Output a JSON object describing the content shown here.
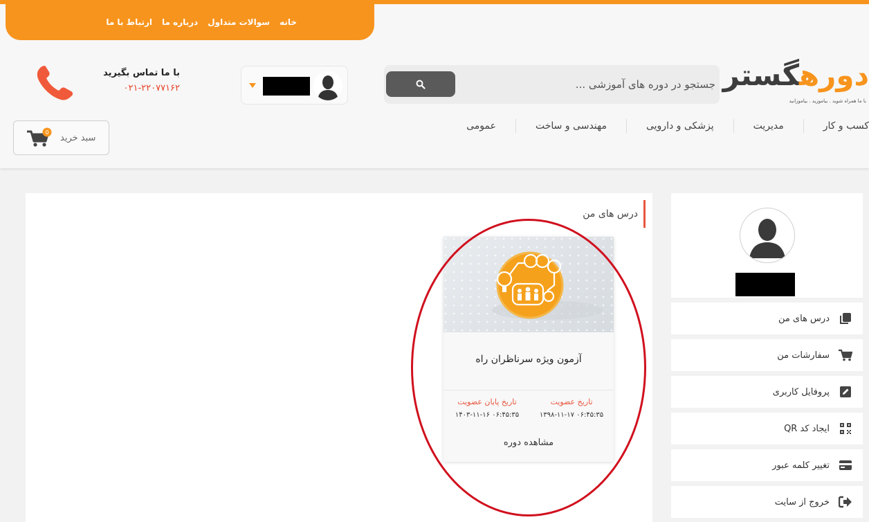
{
  "top_nav": {
    "home": "خانه",
    "faq": "سوالات متداول",
    "about": "درباره ما",
    "contact": "ارتباط با ما"
  },
  "logo": {
    "orange": "دوره",
    "dark": "گستر",
    "tagline": "با ما همراه شوید . بیاموزید . بیاموزانید"
  },
  "search": {
    "placeholder": "جستجو در دوره های آموزشی ..."
  },
  "contact": {
    "title": "با ما تماس بگیرید",
    "phone": "۰۲۱-۲۲۰۷۷۱۶۲"
  },
  "cart": {
    "label": "سبد خرید",
    "count": "0"
  },
  "categories": [
    "کسب و کار",
    "مدیریت",
    "پزشکی و دارویی",
    "مهندسی و ساخت",
    "عمومی"
  ],
  "sidebar": {
    "items": [
      {
        "label": "درس های من",
        "icon": "copy-icon"
      },
      {
        "label": "سفارشات من",
        "icon": "cart-icon"
      },
      {
        "label": "پروفایل کاربری",
        "icon": "edit-icon"
      },
      {
        "label": "ایجاد کد QR",
        "icon": "qr-code-icon"
      },
      {
        "label": "تغییر کلمه عبور",
        "icon": "credit-card-icon"
      },
      {
        "label": "خروج از سایت",
        "icon": "sign-out-icon"
      }
    ]
  },
  "main": {
    "section_title": "درس های من",
    "course": {
      "title": "آزمون ویژه سرناظران راه",
      "join_date_label": "تاریخ عضویت",
      "join_date_value": "۰۶:۴۵:۳۵ ۱۳۹۸-۱۱-۱۷",
      "end_date_label": "تاریخ پایان عضویت",
      "end_date_value": "۰۶:۴۵:۳۵ ۱۴۰۳-۱۱-۱۶",
      "view_label": "مشاهده دوره"
    }
  },
  "colors": {
    "accent": "#f7941d",
    "highlight_red": "#e8553e",
    "annotation": "#d0101e"
  }
}
